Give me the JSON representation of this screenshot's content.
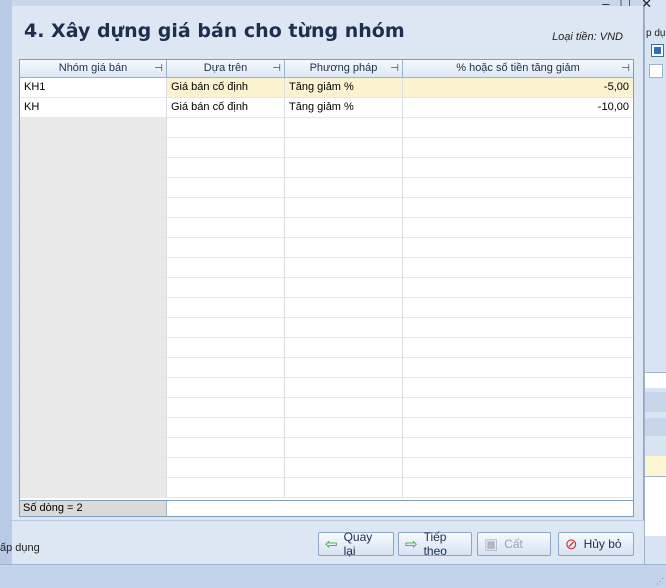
{
  "dialog": {
    "title": "4. Xây dựng giá bán cho từng nhóm",
    "currency_label": "Loại tiền: VND"
  },
  "background": {
    "right_tip": "p dụ",
    "apply_label": "ấp dụng"
  },
  "grid": {
    "columns": [
      {
        "label": "Nhóm giá bán"
      },
      {
        "label": "Dựa trên"
      },
      {
        "label": "Phương pháp"
      },
      {
        "label": "% hoặc số tiền tăng giảm"
      }
    ],
    "pin_glyph": "⊣",
    "rows": [
      {
        "group": "KH1",
        "based_on": "Giá bán cố định",
        "method": "Tăng giảm %",
        "value": "-5,00"
      },
      {
        "group": "KH",
        "based_on": "Giá bán cố định",
        "method": "Tăng giảm %",
        "value": "-10,00"
      }
    ],
    "row_count_label": "Số dòng = 2"
  },
  "buttons": {
    "back": "Quay lại",
    "next": "Tiếp theo",
    "cut": "Cất",
    "cancel": "Hủy bỏ"
  },
  "icons": {
    "back": "arrow-left-icon",
    "next": "arrow-right-icon",
    "cut": "floppy-disk-icon",
    "cancel": "cancel-circle-icon"
  },
  "colors": {
    "selected_row": "#fdf2cf",
    "title": "#1d2f4d"
  }
}
